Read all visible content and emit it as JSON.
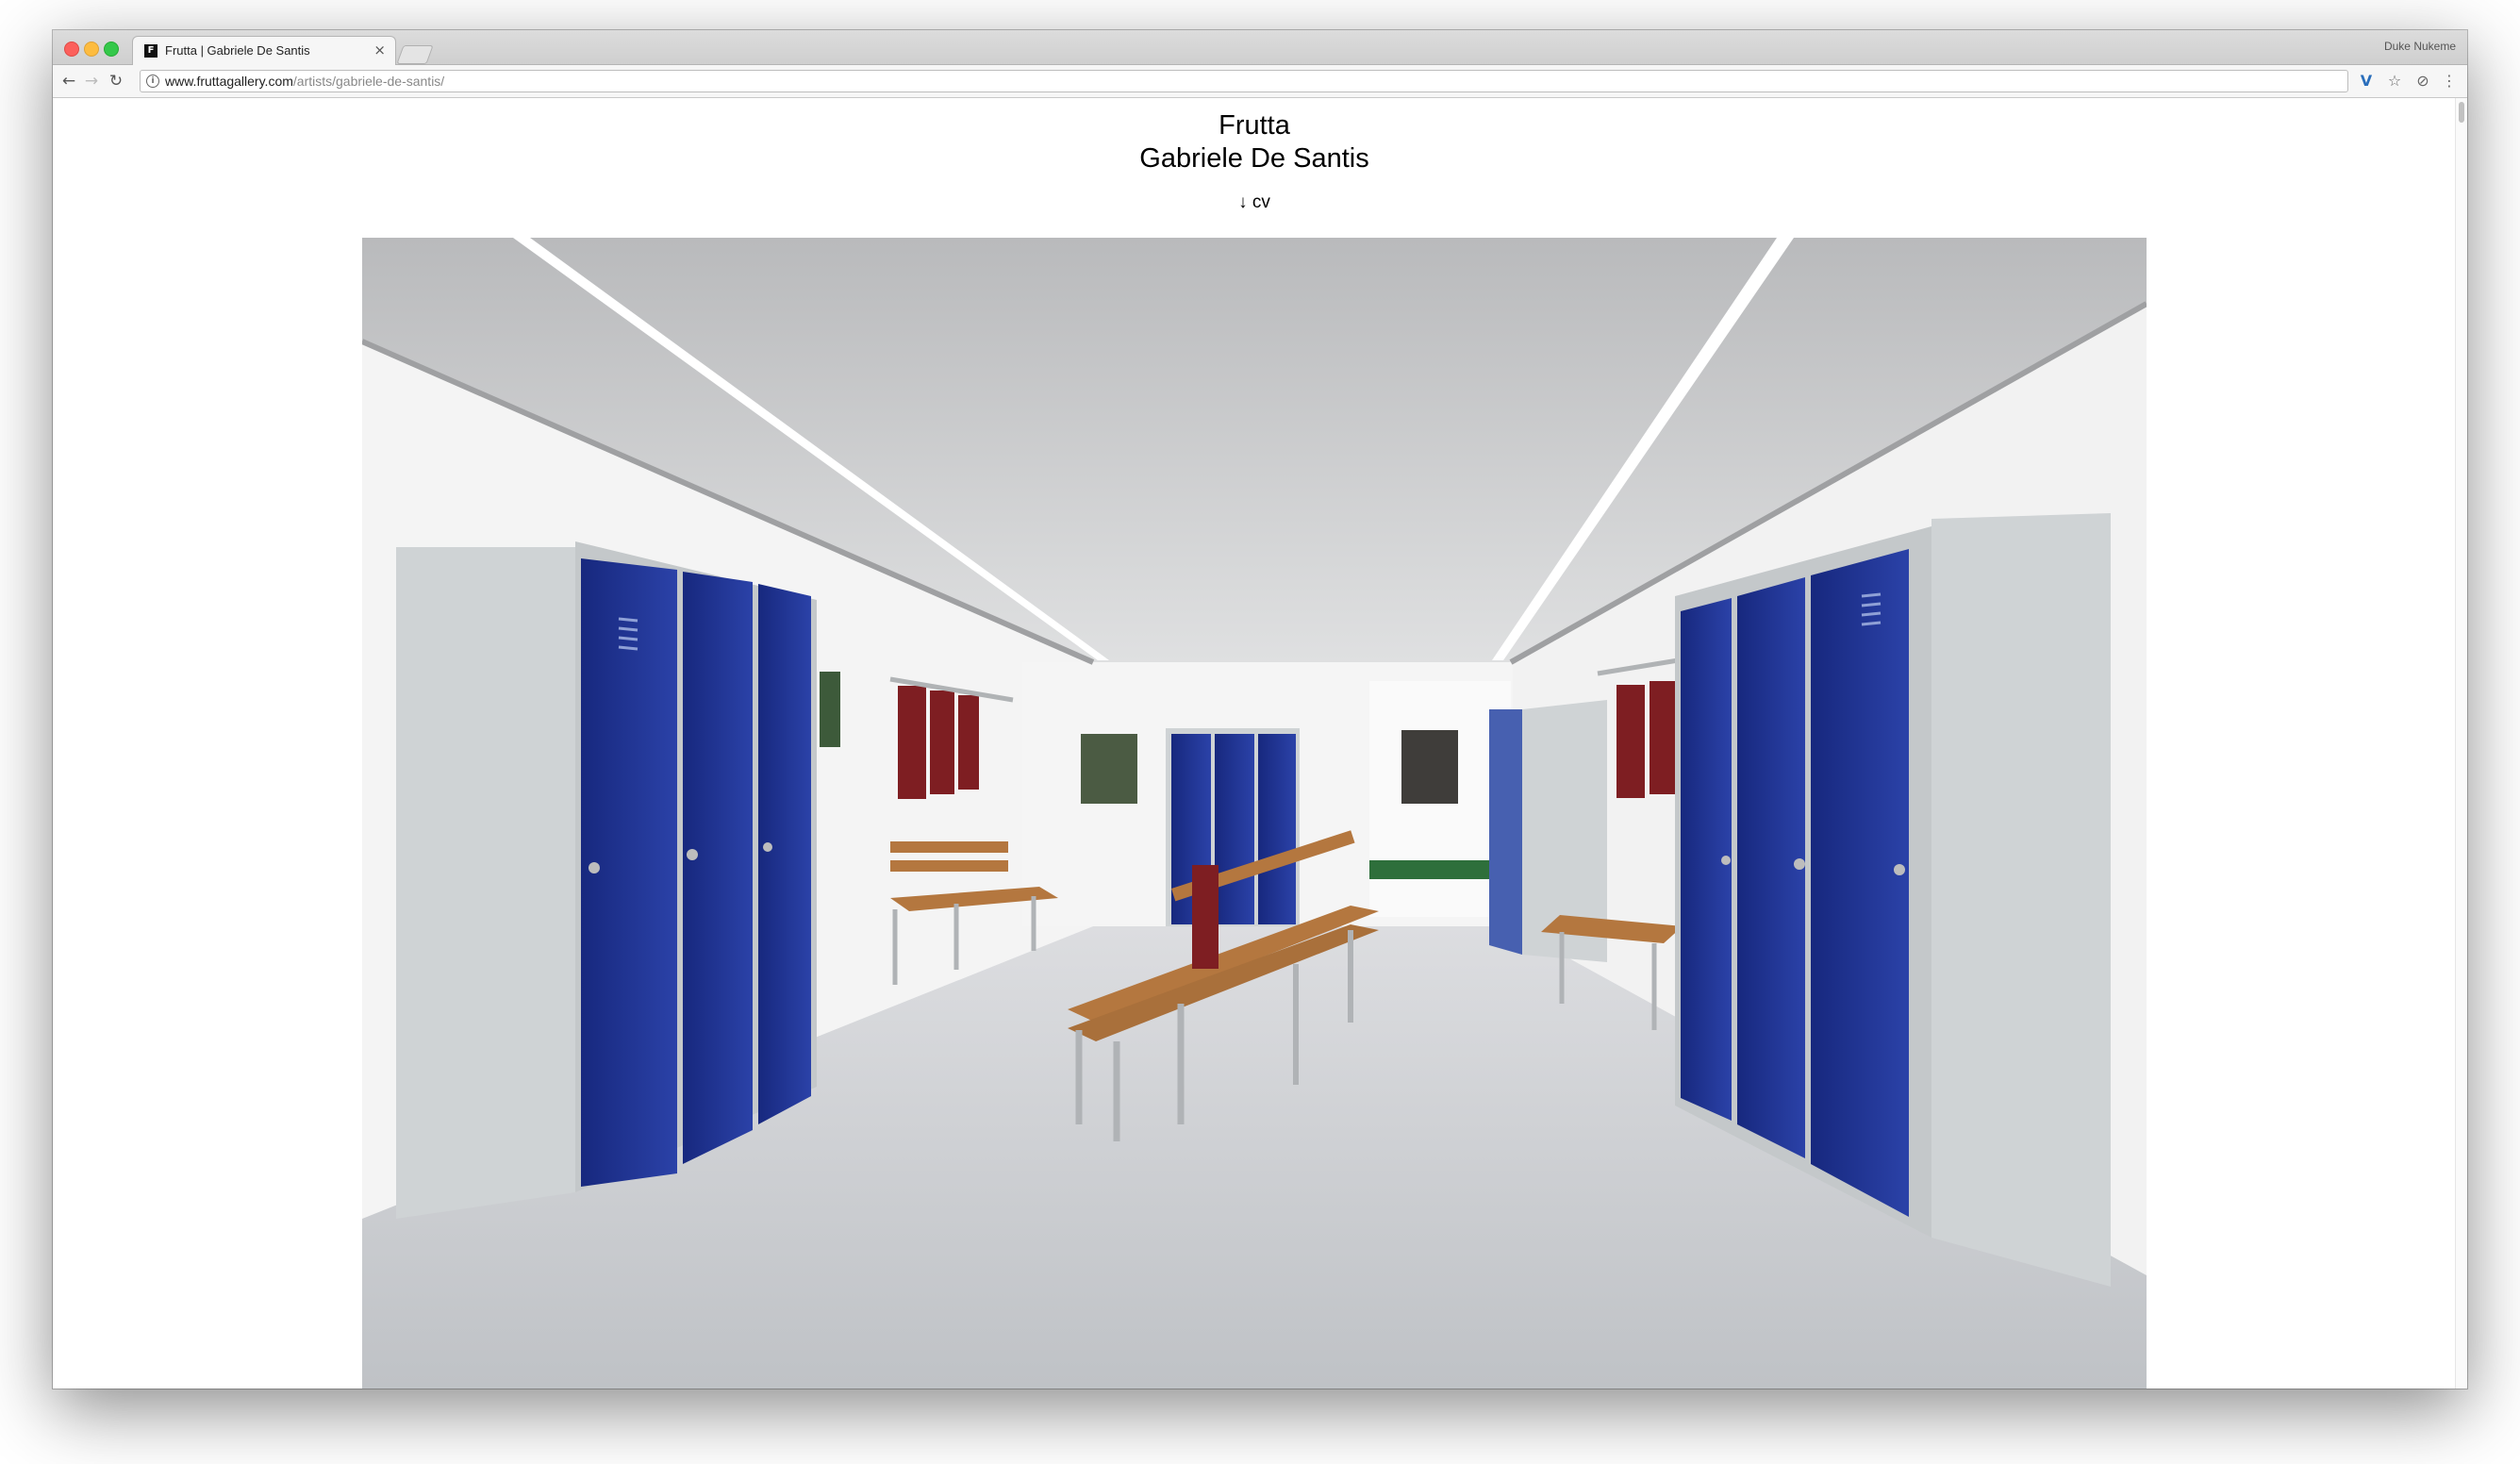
{
  "browser": {
    "tab_title": "Frutta | Gabriele De Santis",
    "tab_favicon": "F",
    "profile_name": "Duke Nukeme",
    "url_host": "www.fruttagallery.com",
    "url_path": "/artists/gabriele-de-santis/",
    "icons": {
      "back": "arrow-left-icon",
      "forward": "arrow-right-icon",
      "reload": "reload-icon",
      "info": "info-icon",
      "extension": "v-extension-icon",
      "bookmark": "star-icon",
      "shield": "shield-extension-icon",
      "menu": "kebab-menu-icon"
    }
  },
  "page": {
    "gallery_name": "Frutta",
    "artist_name": "Gabriele De Santis",
    "cv_link": "↓ cv",
    "photo_subject": "installation view: locker room with blue lockers and benches"
  },
  "colors": {
    "locker_blue": "#1f3596",
    "locker_frame": "#cfd3d5",
    "floor": "#c7c9cc",
    "bench_wood": "#b4773f",
    "jersey": "#7e1e22"
  }
}
